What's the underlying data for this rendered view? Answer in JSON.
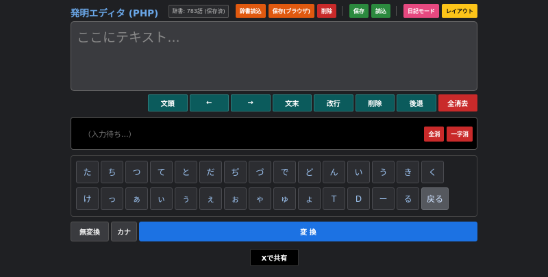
{
  "app": {
    "title": "発明エディタ (PHP)"
  },
  "toolbar": {
    "dict_status": "辞書: 783語 (保存済)",
    "dict_load": "辞書読込",
    "save_browser": "保存(ブラウザ)",
    "delete": "削除",
    "save": "保存",
    "load": "読込",
    "diary_mode": "日記モード",
    "layout": "レイアウト",
    "colors": {
      "orange": "#e0590f",
      "red": "#c92a2a",
      "green": "#2b8a3e",
      "pink": "#e64980",
      "yellow": "#fcc419"
    }
  },
  "editor": {
    "placeholder": "ここにテキスト..."
  },
  "cursor_buttons": [
    "文頭",
    "←",
    "→",
    "文末",
    "改行",
    "削除",
    "後退",
    "全消去"
  ],
  "input": {
    "status": "（入力待ち...）",
    "clear_all": "全消",
    "delete_one": "一字消"
  },
  "kana_keys": {
    "row1": [
      "た",
      "ち",
      "つ",
      "て",
      "と",
      "だ",
      "ぢ",
      "づ",
      "で",
      "ど",
      "ん",
      "い",
      "う",
      "き",
      "く"
    ],
    "row2": [
      "け",
      "っ",
      "ぁ",
      "ぃ",
      "ぅ",
      "ぇ",
      "ぉ",
      "ゃ",
      "ゅ",
      "ょ",
      "T",
      "D",
      "ー",
      "る"
    ],
    "back": "戻る"
  },
  "conversion": {
    "muhenkan": "無変換",
    "kana": "カナ",
    "henkan": "変 換",
    "accent": "#1c72e3"
  },
  "share": {
    "label": "Xで共有"
  }
}
